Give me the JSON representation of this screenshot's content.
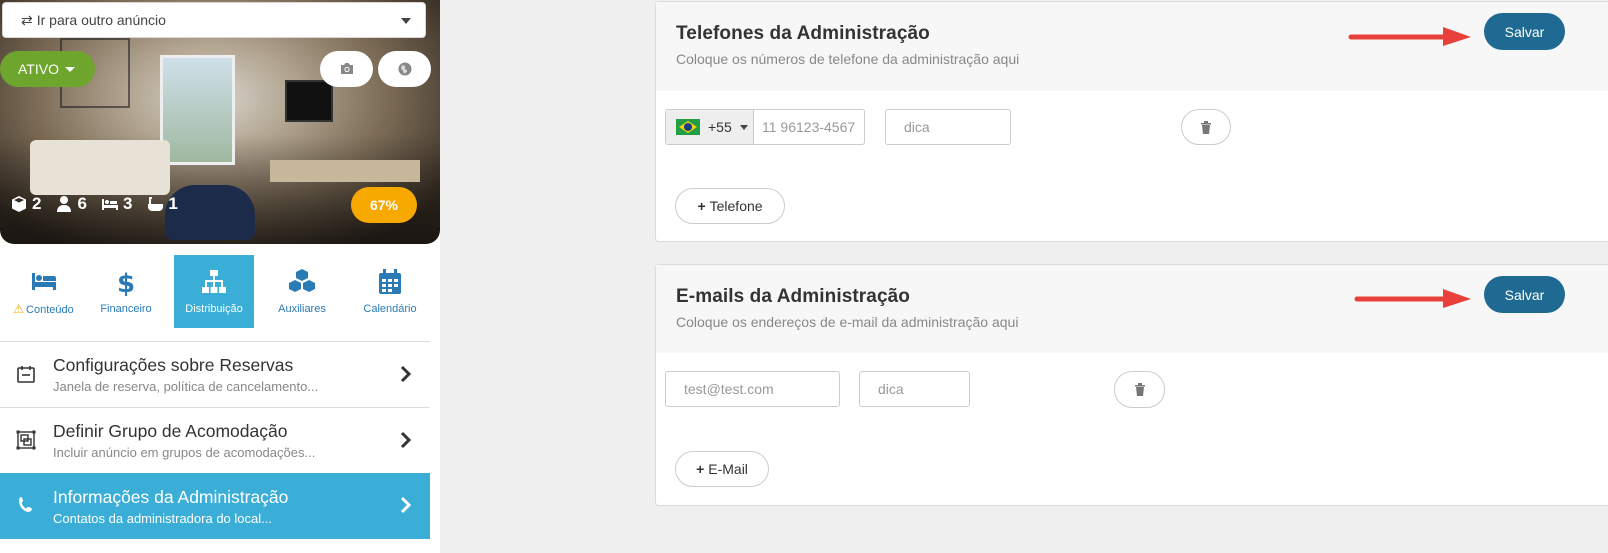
{
  "listing_select": {
    "label": "Ir para outro anúncio"
  },
  "hero": {
    "status_label": "ATIVO",
    "stats": {
      "units": "2",
      "guests": "6",
      "beds": "3",
      "baths": "1"
    },
    "completion": "67%"
  },
  "tabs": [
    {
      "label": "Conteúdo",
      "icon": "bed-icon",
      "warning": true
    },
    {
      "label": "Financeiro",
      "icon": "dollar-icon"
    },
    {
      "label": "Distribuição",
      "icon": "sitemap-icon",
      "active": true
    },
    {
      "label": "Auxiliares",
      "icon": "cubes-icon"
    },
    {
      "label": "Calendário",
      "icon": "calendar-icon"
    }
  ],
  "menu": [
    {
      "title": "Configurações sobre Reservas",
      "subtitle": "Janela de reserva, política de cancelamento..."
    },
    {
      "title": "Definir Grupo de Acomodação",
      "subtitle": "Incluir anúncio em grupos de acomodações..."
    },
    {
      "title": "Informações da Administração",
      "subtitle": "Contatos da administradora do local...",
      "active": true
    }
  ],
  "phones_card": {
    "title": "Telefones da Administração",
    "subtitle": "Coloque os números de telefone da administração aqui",
    "save_label": "Salvar",
    "country_code": "+55",
    "phone_placeholder": "11 96123-4567",
    "hint_placeholder": "dica",
    "add_label": "Telefone"
  },
  "emails_card": {
    "title": "E-mails da Administração",
    "subtitle": "Coloque os endereços de e-mail da administração aqui",
    "save_label": "Salvar",
    "email_placeholder": "test@test.com",
    "hint_placeholder": "dica",
    "add_label": "E-Mail"
  },
  "colors": {
    "accent": "#3baed8",
    "save": "#1e6a92",
    "status_green": "#6ea52c",
    "completion": "#f8a900",
    "arrow": "#e8403a"
  }
}
